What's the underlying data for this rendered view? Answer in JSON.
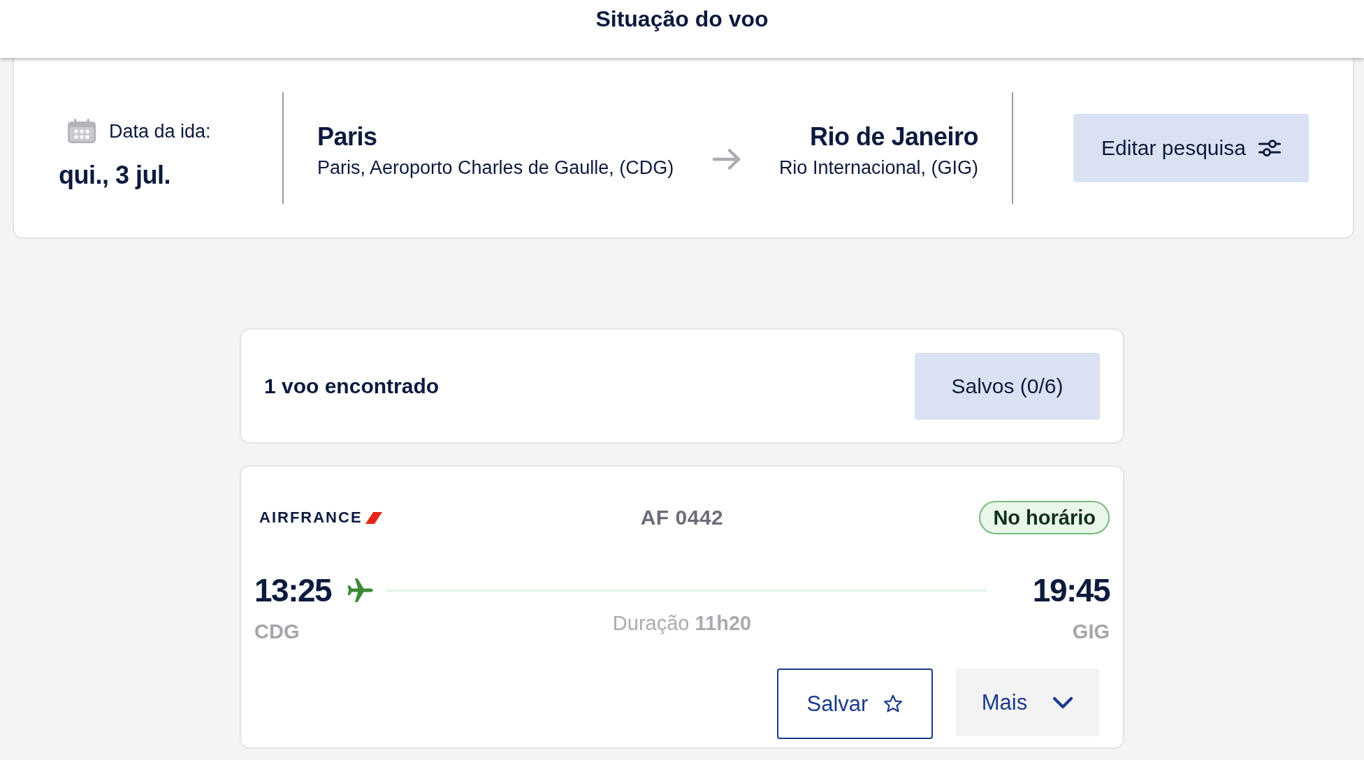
{
  "header": {
    "title": "Situação do voo"
  },
  "search": {
    "date_label": "Data da ida:",
    "date": "qui., 3 jul.",
    "origin": {
      "city": "Paris",
      "airport": "Paris, Aeroporto Charles de Gaulle, (CDG)"
    },
    "destination": {
      "city": "Rio de Janeiro",
      "airport": "Rio Internacional, (GIG)"
    },
    "edit_button": "Editar pesquisa"
  },
  "results": {
    "count": "1 voo encontrado",
    "saved_button": "Salvos (0/6)"
  },
  "flights": [
    {
      "airline": "AIRFRANCE",
      "number": "AF 0442",
      "status": {
        "kind": "on_time",
        "label": "No horário"
      },
      "departure": {
        "time": "13:25",
        "airport": "CDG"
      },
      "arrival": {
        "time": "19:45",
        "airport": "GIG"
      },
      "duration": "Duração **11h20**",
      "save_button": "Salvar",
      "saved": false,
      "more_button": "Mais"
    }
  ]
}
